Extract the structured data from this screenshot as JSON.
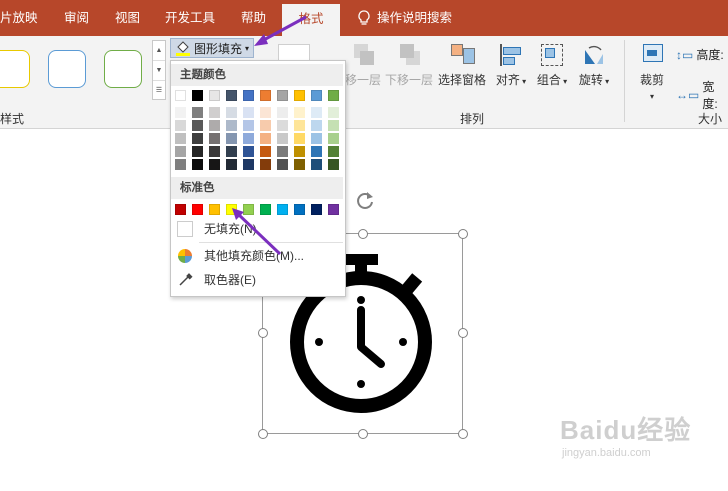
{
  "tabs": {
    "slideshow": "片放映",
    "review": "审阅",
    "view": "视图",
    "developer": "开发工具",
    "help": "帮助",
    "format": "格式",
    "tell_me": "操作说明搜索"
  },
  "ribbon": {
    "styles_group_label": "样式",
    "shape_fill_button": "图形填充",
    "arrange_group_label": "排列",
    "bring_forward": "移一层",
    "send_backward": "下移一层",
    "selection_pane": "选择窗格",
    "align": "对齐",
    "group": "组合",
    "rotate": "旋转",
    "crop": "裁剪",
    "height_label": "高度:",
    "width_label": "宽度:",
    "size_group_label": "大小"
  },
  "dropdown": {
    "theme_colors_header": "主题颜色",
    "standard_colors_header": "标准色",
    "no_fill": "无填充(N)",
    "more_fill_colors": "其他填充颜色(M)...",
    "eyedropper": "取色器(E)",
    "theme_top_row": [
      "#ffffff",
      "#000000",
      "#e7e6e6",
      "#44546a",
      "#4472c4",
      "#ed7d31",
      "#a5a5a5",
      "#ffc000",
      "#5b9bd5",
      "#70ad47"
    ],
    "theme_shades": [
      [
        "#f2f2f2",
        "#7f7f7f",
        "#d0cece",
        "#d6dce4",
        "#d9e2f3",
        "#fbe5d5",
        "#ededed",
        "#fff2cc",
        "#deebf6",
        "#e2efd9"
      ],
      [
        "#d8d8d8",
        "#595959",
        "#aeabab",
        "#adb9ca",
        "#b4c6e7",
        "#f7cbac",
        "#dbdbdb",
        "#fee599",
        "#bdd7ee",
        "#c5e0b3"
      ],
      [
        "#bfbfbf",
        "#3f3f3f",
        "#757070",
        "#8496b0",
        "#8eaadb",
        "#f4b183",
        "#c9c9c9",
        "#ffd965",
        "#9cc3e5",
        "#a8d08d"
      ],
      [
        "#a5a5a5",
        "#262626",
        "#3a3838",
        "#323f4f",
        "#2f5496",
        "#c55a11",
        "#7b7b7b",
        "#bf9000",
        "#2e75b5",
        "#538135"
      ],
      [
        "#7f7f7f",
        "#0c0c0c",
        "#171616",
        "#222a35",
        "#1e3864",
        "#833c0b",
        "#525252",
        "#7f6000",
        "#1e4e79",
        "#375623"
      ]
    ],
    "standard_colors": [
      "#c00000",
      "#ff0000",
      "#ffc000",
      "#ffff00",
      "#92d050",
      "#00b050",
      "#00b0f0",
      "#0070c0",
      "#002060",
      "#7030a0"
    ]
  },
  "colors": {
    "tab_bar": "#b7472a",
    "ribbon_bg": "#f3f3f3",
    "accent_arrow": "#7b2fbe"
  },
  "watermark": {
    "brand": "Baidu经验",
    "url": "jingyan.baidu.com"
  }
}
